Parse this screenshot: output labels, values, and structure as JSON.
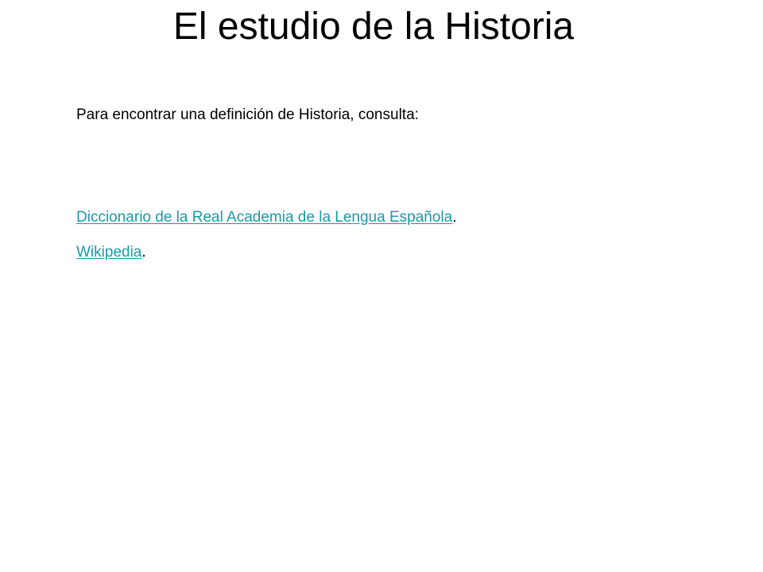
{
  "slide": {
    "title": "El estudio de la Historia",
    "intro": "Para encontrar una definición de Historia, consulta:",
    "links": [
      {
        "label": "Diccionario de la Real Academia de la Lengua Española",
        "suffix": "."
      },
      {
        "label": "Wikipedia",
        "suffix": "."
      }
    ]
  },
  "colors": {
    "link": "#1a9aa8",
    "text": "#000000",
    "background": "#ffffff"
  }
}
